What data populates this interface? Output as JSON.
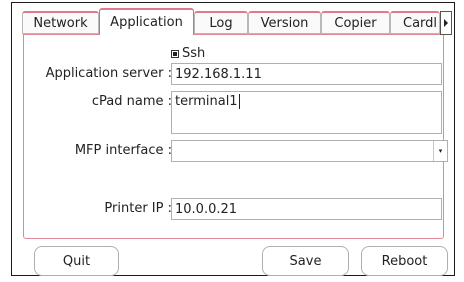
{
  "tabs": [
    {
      "label": "Network"
    },
    {
      "label": "Application"
    },
    {
      "label": "Log"
    },
    {
      "label": "Version"
    },
    {
      "label": "Copier"
    },
    {
      "label": "Cardl"
    }
  ],
  "active_tab": "Application",
  "form": {
    "ssh_label": "Ssh",
    "ssh_checked": true,
    "app_server_label": "Application server :",
    "app_server_value": "192.168.1.11",
    "cpad_name_label": "cPad name :",
    "cpad_name_value": "terminal1",
    "mfp_interface_label": "MFP interface :",
    "mfp_interface_value": "",
    "printer_ip_label": "Printer IP :",
    "printer_ip_value": "10.0.0.21"
  },
  "buttons": {
    "quit": "Quit",
    "save": "Save",
    "reboot": "Reboot"
  },
  "colors": {
    "tab_accent": "#e07a8a",
    "panel_border": "#e08a98"
  }
}
